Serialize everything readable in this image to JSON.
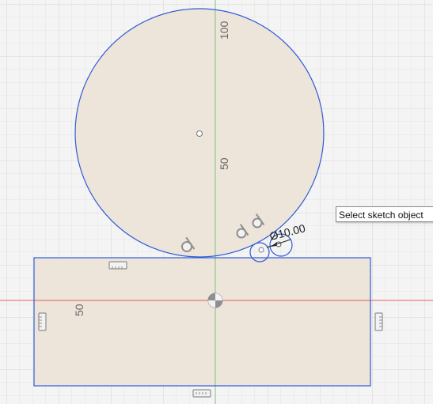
{
  "viewport": {
    "background": "#f4f4f4",
    "grid_minor_color": "#e4e4e4",
    "grid_major_color": "#d4d4d4",
    "x_axis_color": "#e06060",
    "y_axis_color": "#7cc47c"
  },
  "sketch": {
    "profile_fill": "#ede4da",
    "line_color": "#2e5bd8",
    "constraint_color": "#8f8f8f",
    "constraint_icons": [
      "horizontal-constraint-icon",
      "vertical-constraint-icon",
      "tangent-constraint-icon",
      "coincident-constraint-icon",
      "origin-icon"
    ]
  },
  "ruler_labels": {
    "y_100": "100",
    "y_50": "50",
    "rect_50": "50"
  },
  "dimension": {
    "text": "Ø10.00"
  },
  "tooltip": {
    "text": "Select sketch object"
  }
}
